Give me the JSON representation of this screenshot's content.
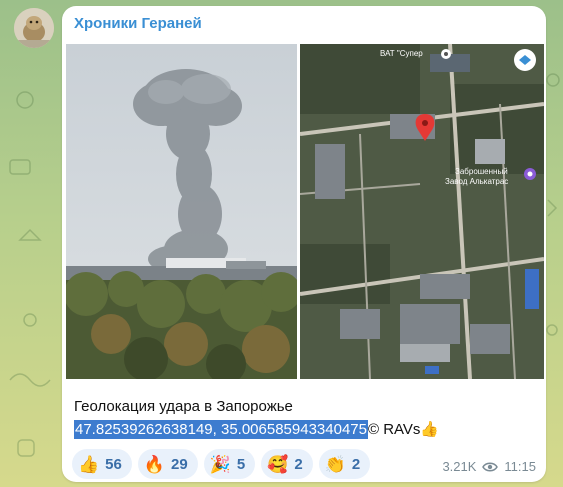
{
  "channel": {
    "name": "Хроники Гераней",
    "avatar_icon": "avatar-icon"
  },
  "map_labels": {
    "poi_top": "ВАТ \"Супер",
    "poi_mid_line1": "Заброшенный",
    "poi_mid_line2": "Завод Алькатрас"
  },
  "message": {
    "caption_line1": "Геолокация удара в Запорожье",
    "coordinates": "47.82539262638149, 35.006585943340475",
    "signature": "© RAVs👍"
  },
  "reactions": [
    {
      "emoji": "👍",
      "count": "56"
    },
    {
      "emoji": "🔥",
      "count": "29"
    },
    {
      "emoji": "🎉",
      "count": "5"
    },
    {
      "emoji": "🥰",
      "count": "2"
    },
    {
      "emoji": "👏",
      "count": "2"
    }
  ],
  "meta": {
    "views": "3.21K",
    "time": "11:15"
  },
  "colors": {
    "accent": "#3a8fd4",
    "selection": "#3d7ccf",
    "reaction_bg": "#e9f1fb"
  }
}
